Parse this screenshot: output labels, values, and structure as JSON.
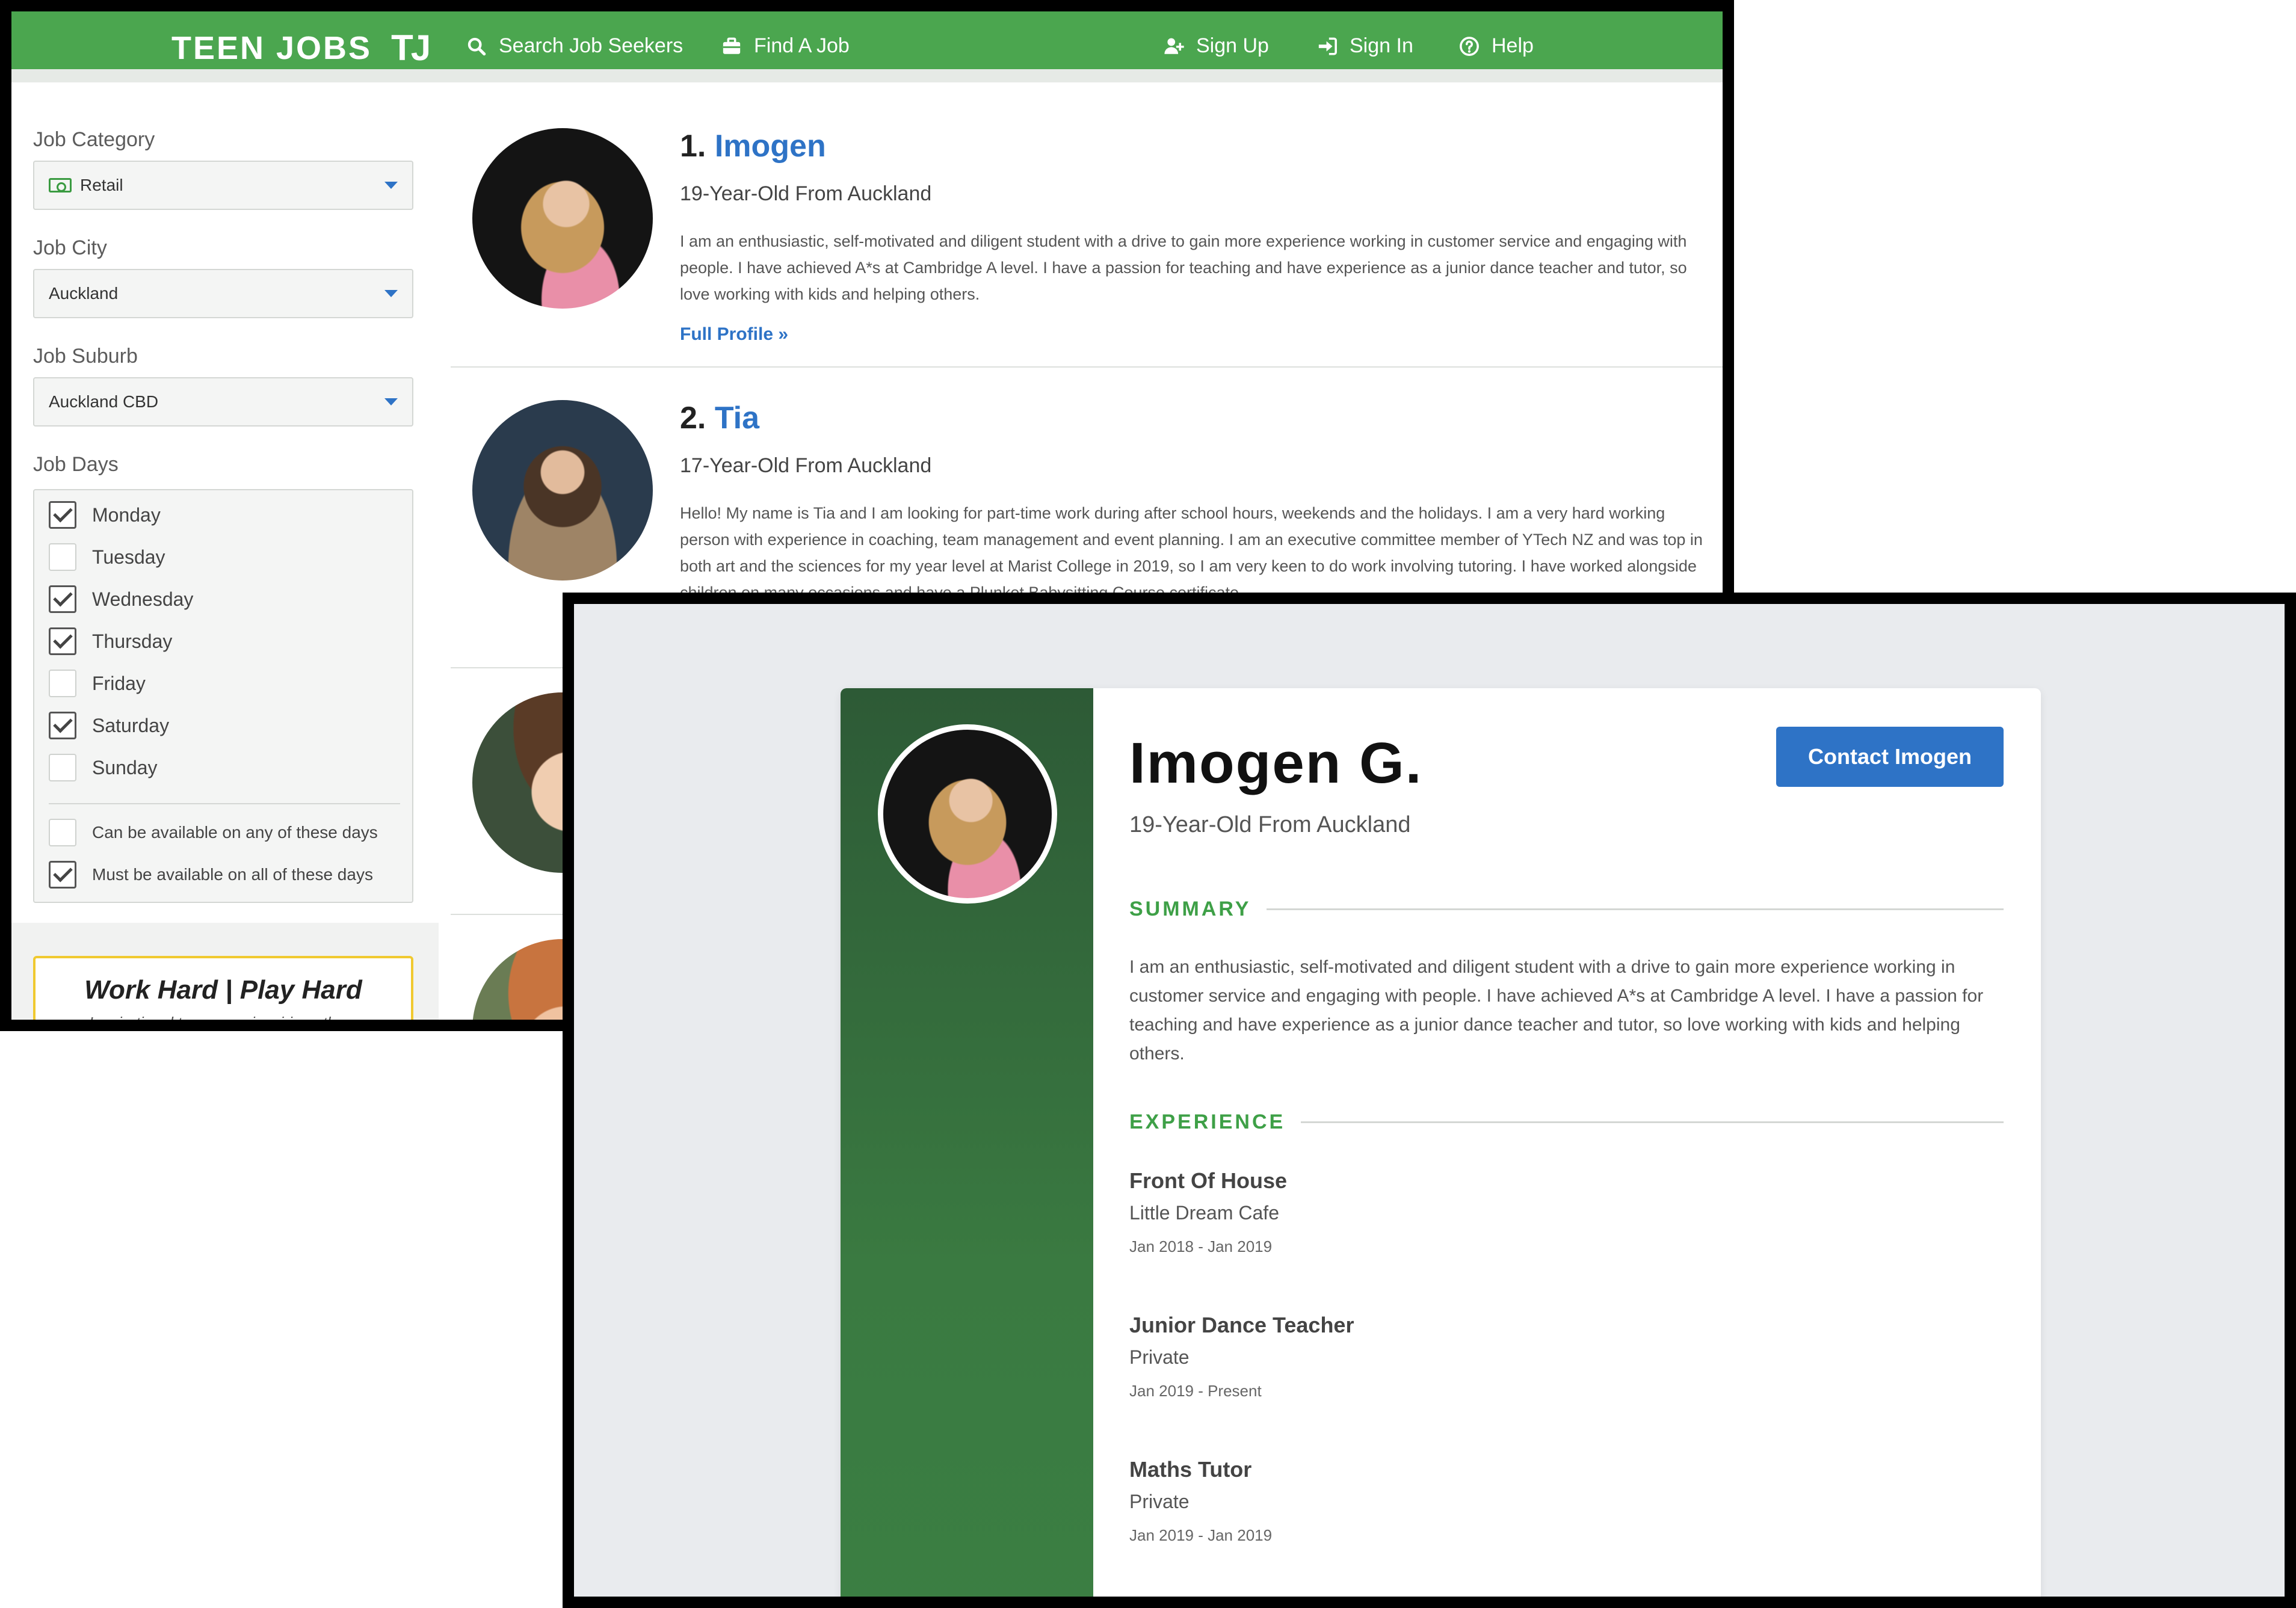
{
  "colors": {
    "brand_green": "#4ba64f",
    "link_blue": "#2e73c6",
    "section_green": "#3ea047",
    "promo_border": "#f0c930"
  },
  "topbar": {
    "logo_text": "TEEN JOBS",
    "logo_mark": "TJ",
    "nav": [
      {
        "label": "Search Job Seekers",
        "icon": "search-icon"
      },
      {
        "label": "Find A Job",
        "icon": "briefcase-icon"
      },
      {
        "label": "Sign Up",
        "icon": "user-plus-icon"
      },
      {
        "label": "Sign In",
        "icon": "sign-in-icon"
      },
      {
        "label": "Help",
        "icon": "question-circle-icon"
      }
    ]
  },
  "filters": {
    "category_label": "Job Category",
    "category_value": "Retail",
    "city_label": "Job City",
    "city_value": "Auckland",
    "suburb_label": "Job Suburb",
    "suburb_value": "Auckland CBD",
    "days_label": "Job Days",
    "days": [
      {
        "label": "Monday",
        "checked": true
      },
      {
        "label": "Tuesday",
        "checked": false
      },
      {
        "label": "Wednesday",
        "checked": true
      },
      {
        "label": "Thursday",
        "checked": true
      },
      {
        "label": "Friday",
        "checked": false
      },
      {
        "label": "Saturday",
        "checked": true
      },
      {
        "label": "Sunday",
        "checked": false
      }
    ],
    "any_days": {
      "label": "Can be available on any of these days",
      "checked": false
    },
    "all_days": {
      "label": "Must be available on all of these days",
      "checked": true
    }
  },
  "promo": {
    "title": "Work Hard | Play Hard",
    "subtitle": "Inspirational teenagers inspiring others"
  },
  "results": [
    {
      "number": "1.",
      "name": "Imogen",
      "subtitle": "19-Year-Old From Auckland",
      "bio": "I am an enthusiastic, self-motivated and diligent student with a drive to gain more experience working in customer service and engaging with people. I have achieved A*s at Cambridge A level. I have a passion for teaching and have experience as a junior dance teacher and tutor, so love working with kids and helping others.",
      "link": "Full Profile »"
    },
    {
      "number": "2.",
      "name": "Tia",
      "subtitle": "17-Year-Old From Auckland",
      "bio": "Hello! My name is Tia and I am looking for part-time work during after school hours, weekends and the holidays. I am a very hard working person with experience in coaching, team management and event planning. I am an executive committee member of YTech NZ and was top in both art and the sciences for my year level at Marist College in 2019, so I am very keen to do work involving tutoring. I have worked alongside children on many occasions and have a Plunket Babysitting Course certificate."
    }
  ],
  "profile": {
    "name": "Imogen G.",
    "subtitle": "19-Year-Old From Auckland",
    "contact_label": "Contact Imogen",
    "summary_heading": "SUMMARY",
    "summary": "I am an enthusiastic, self-motivated and diligent student with a drive to gain more experience working in customer service and engaging with people. I have achieved A*s at Cambridge A level. I have a passion for teaching and have experience as a junior dance teacher and tutor, so love working with kids and helping others.",
    "experience_heading": "EXPERIENCE",
    "experience": [
      {
        "title": "Front Of House",
        "company": "Little Dream Cafe",
        "dates": "Jan 2018 - Jan 2019"
      },
      {
        "title": "Junior Dance Teacher",
        "company": "Private",
        "dates": "Jan 2019 - Present"
      },
      {
        "title": "Maths Tutor",
        "company": "Private",
        "dates": "Jan 2019 - Jan 2019"
      }
    ]
  }
}
